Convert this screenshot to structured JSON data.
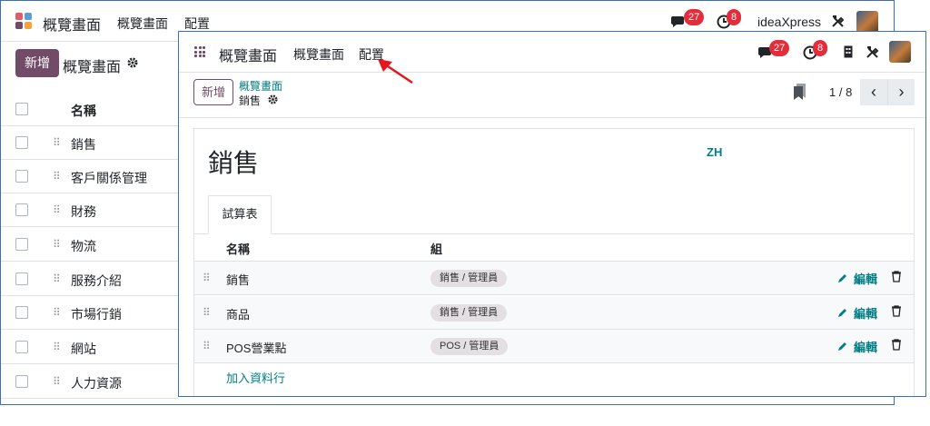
{
  "bg_window": {
    "app_title": "概覽畫面",
    "menu": [
      "概覽畫面",
      "配置"
    ],
    "chat_badge": "27",
    "activity_badge": "8",
    "company": "ideaXpress",
    "new_button": "新增",
    "breadcrumb": "概覽畫面",
    "list_header": "名稱",
    "rows": [
      "銷售",
      "客戶關係管理",
      "財務",
      "物流",
      "服務介紹",
      "市場行銷",
      "網站",
      "人力資源"
    ]
  },
  "fg_window": {
    "app_title": "概覽畫面",
    "menu": [
      "概覽畫面",
      "配置"
    ],
    "chat_badge": "27",
    "activity_badge": "8",
    "new_button": "新增",
    "breadcrumb_parent": "概覽畫面",
    "breadcrumb_current": "銷售",
    "pager": "1 / 8",
    "record_title": "銷售",
    "lang_badge": "ZH",
    "tab": "試算表",
    "columns": [
      "名稱",
      "組"
    ],
    "lines": [
      {
        "name": "銷售",
        "group": "銷售 / 管理員",
        "edit": "編輯"
      },
      {
        "name": "商品",
        "group": "銷售 / 管理員",
        "edit": "編輯"
      },
      {
        "name": "POS營業點",
        "group": "POS / 管理員",
        "edit": "編輯"
      }
    ],
    "add_line": "加入資料行"
  },
  "colors": {
    "brand": "#714b67",
    "accent": "#017e84",
    "badge": "#e22d3b",
    "annotation_arrow": "#e8131b"
  }
}
